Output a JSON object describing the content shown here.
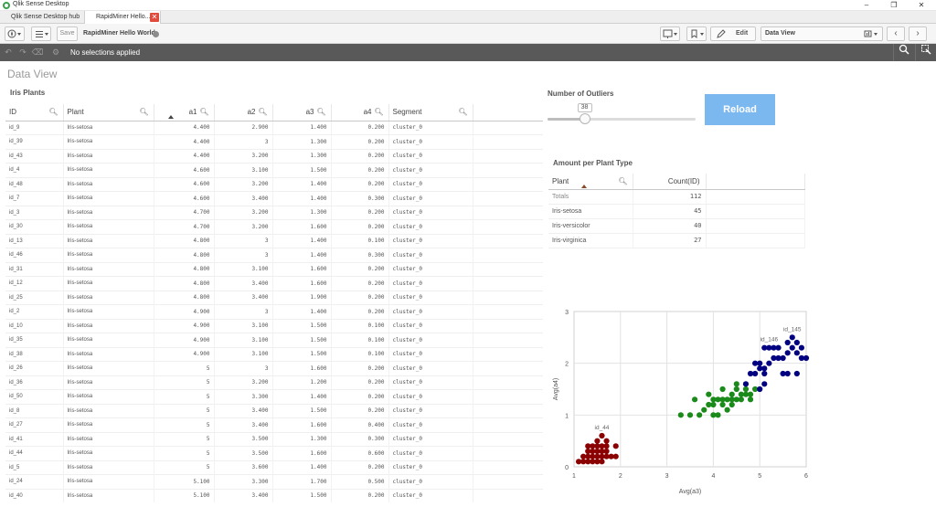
{
  "window": {
    "title": "Qlik Sense Desktop",
    "minimize": "–",
    "maximize": "❐",
    "close": "✕"
  },
  "tabs": [
    {
      "label": "Qlik Sense Desktop hub"
    },
    {
      "label": "RapidMiner Hello..."
    }
  ],
  "tab_close_glyph": "✕",
  "toolbar": {
    "save_label": "Save",
    "app_name": "RapidMiner Hello World",
    "edit_label": "Edit",
    "sheet_name": "Data View",
    "prev": "‹",
    "next": "›"
  },
  "selections": {
    "text": "No selections applied"
  },
  "sheet": {
    "title": "Data View"
  },
  "iris_table": {
    "title": "Iris Plants",
    "columns": [
      "ID",
      "Plant",
      "a1",
      "a2",
      "a3",
      "a4",
      "Segment"
    ],
    "rows": [
      [
        "id_9",
        "Iris-setosa",
        "4.400",
        "2.900",
        "1.400",
        "0.200",
        "cluster_0"
      ],
      [
        "id_39",
        "Iris-setosa",
        "4.400",
        "3",
        "1.300",
        "0.200",
        "cluster_0"
      ],
      [
        "id_43",
        "Iris-setosa",
        "4.400",
        "3.200",
        "1.300",
        "0.200",
        "cluster_0"
      ],
      [
        "id_4",
        "Iris-setosa",
        "4.600",
        "3.100",
        "1.500",
        "0.200",
        "cluster_0"
      ],
      [
        "id_48",
        "Iris-setosa",
        "4.600",
        "3.200",
        "1.400",
        "0.200",
        "cluster_0"
      ],
      [
        "id_7",
        "Iris-setosa",
        "4.600",
        "3.400",
        "1.400",
        "0.300",
        "cluster_0"
      ],
      [
        "id_3",
        "Iris-setosa",
        "4.700",
        "3.200",
        "1.300",
        "0.200",
        "cluster_0"
      ],
      [
        "id_30",
        "Iris-setosa",
        "4.700",
        "3.200",
        "1.600",
        "0.200",
        "cluster_0"
      ],
      [
        "id_13",
        "Iris-setosa",
        "4.800",
        "3",
        "1.400",
        "0.100",
        "cluster_0"
      ],
      [
        "id_46",
        "Iris-setosa",
        "4.800",
        "3",
        "1.400",
        "0.300",
        "cluster_0"
      ],
      [
        "id_31",
        "Iris-setosa",
        "4.800",
        "3.100",
        "1.600",
        "0.200",
        "cluster_0"
      ],
      [
        "id_12",
        "Iris-setosa",
        "4.800",
        "3.400",
        "1.600",
        "0.200",
        "cluster_0"
      ],
      [
        "id_25",
        "Iris-setosa",
        "4.800",
        "3.400",
        "1.900",
        "0.200",
        "cluster_0"
      ],
      [
        "id_2",
        "Iris-setosa",
        "4.900",
        "3",
        "1.400",
        "0.200",
        "cluster_0"
      ],
      [
        "id_10",
        "Iris-setosa",
        "4.900",
        "3.100",
        "1.500",
        "0.100",
        "cluster_0"
      ],
      [
        "id_35",
        "Iris-setosa",
        "4.900",
        "3.100",
        "1.500",
        "0.100",
        "cluster_0"
      ],
      [
        "id_38",
        "Iris-setosa",
        "4.900",
        "3.100",
        "1.500",
        "0.100",
        "cluster_0"
      ],
      [
        "id_26",
        "Iris-setosa",
        "5",
        "3",
        "1.600",
        "0.200",
        "cluster_0"
      ],
      [
        "id_36",
        "Iris-setosa",
        "5",
        "3.200",
        "1.200",
        "0.200",
        "cluster_0"
      ],
      [
        "id_50",
        "Iris-setosa",
        "5",
        "3.300",
        "1.400",
        "0.200",
        "cluster_0"
      ],
      [
        "id_8",
        "Iris-setosa",
        "5",
        "3.400",
        "1.500",
        "0.200",
        "cluster_0"
      ],
      [
        "id_27",
        "Iris-setosa",
        "5",
        "3.400",
        "1.600",
        "0.400",
        "cluster_0"
      ],
      [
        "id_41",
        "Iris-setosa",
        "5",
        "3.500",
        "1.300",
        "0.300",
        "cluster_0"
      ],
      [
        "id_44",
        "Iris-setosa",
        "5",
        "3.500",
        "1.600",
        "0.600",
        "cluster_0"
      ],
      [
        "id_5",
        "Iris-setosa",
        "5",
        "3.600",
        "1.400",
        "0.200",
        "cluster_0"
      ],
      [
        "id_24",
        "Iris-setosa",
        "5.100",
        "3.300",
        "1.700",
        "0.500",
        "cluster_0"
      ],
      [
        "id_40",
        "Iris-setosa",
        "5.100",
        "3.400",
        "1.500",
        "0.200",
        "cluster_0"
      ]
    ]
  },
  "outliers": {
    "title": "Number of Outliers",
    "value": "38",
    "fraction": 0.25
  },
  "reload": {
    "label": "Reload",
    "color": "#7cb8f0"
  },
  "amount_table": {
    "title": "Amount per Plant Type",
    "columns": [
      "Plant",
      "Count(ID)"
    ],
    "totals_label": "Totals",
    "totals_value": "112",
    "rows": [
      [
        "Iris-setosa",
        "45"
      ],
      [
        "Iris-versicolor",
        "40"
      ],
      [
        "Iris-virginica",
        "27"
      ]
    ]
  },
  "chart_data": {
    "type": "scatter",
    "xlabel": "Avg(a3)",
    "ylabel": "Avg(a4)",
    "xlim": [
      1,
      6
    ],
    "ylim": [
      0,
      3
    ],
    "xticks": [
      "1",
      "2",
      "3",
      "4",
      "5",
      "6"
    ],
    "yticks": [
      "0",
      "1",
      "2",
      "3"
    ],
    "grid": true,
    "series": [
      {
        "color": "#8b0000",
        "points": [
          [
            1.4,
            0.2
          ],
          [
            1.5,
            0.2
          ],
          [
            1.3,
            0.2
          ],
          [
            1.6,
            0.2
          ],
          [
            1.4,
            0.3
          ],
          [
            1.5,
            0.3
          ],
          [
            1.7,
            0.3
          ],
          [
            1.2,
            0.2
          ],
          [
            1.6,
            0.4
          ],
          [
            1.5,
            0.4
          ],
          [
            1.3,
            0.3
          ],
          [
            1.9,
            0.2
          ],
          [
            1.4,
            0.1
          ],
          [
            1.5,
            0.1
          ],
          [
            1.1,
            0.1
          ],
          [
            1.7,
            0.5
          ],
          [
            1.6,
            0.6
          ],
          [
            1.3,
            0.4
          ],
          [
            1.9,
            0.4
          ],
          [
            1.7,
            0.2
          ],
          [
            1.4,
            0.4
          ],
          [
            1.8,
            0.2
          ],
          [
            1.6,
            0.3
          ],
          [
            1.2,
            0.1
          ],
          [
            1.5,
            0.5
          ],
          [
            1.7,
            0.4
          ],
          [
            1.3,
            0.1
          ],
          [
            1.6,
            0.1
          ]
        ]
      },
      {
        "color": "#1a8a1a",
        "points": [
          [
            3.6,
            1.3
          ],
          [
            3.5,
            1.0
          ],
          [
            3.9,
            1.4
          ],
          [
            3.7,
            1.0
          ],
          [
            3.8,
            1.1
          ],
          [
            3.9,
            1.2
          ],
          [
            4.0,
            1.3
          ],
          [
            4.1,
            1.3
          ],
          [
            4.0,
            1.0
          ],
          [
            4.2,
            1.2
          ],
          [
            4.3,
            1.3
          ],
          [
            4.4,
            1.4
          ],
          [
            4.5,
            1.5
          ],
          [
            4.6,
            1.4
          ],
          [
            4.4,
            1.2
          ],
          [
            4.0,
            1.2
          ],
          [
            4.2,
            1.3
          ],
          [
            4.1,
            1.0
          ],
          [
            4.5,
            1.3
          ],
          [
            4.7,
            1.4
          ],
          [
            4.4,
            1.3
          ],
          [
            4.8,
            1.4
          ],
          [
            4.7,
            1.5
          ],
          [
            4.9,
            1.5
          ],
          [
            4.6,
            1.3
          ],
          [
            4.5,
            1.6
          ],
          [
            4.3,
            1.1
          ],
          [
            3.3,
            1.0
          ],
          [
            4.2,
            1.5
          ],
          [
            4.8,
            1.3
          ]
        ]
      },
      {
        "color": "#000080",
        "points": [
          [
            4.9,
            1.8
          ],
          [
            5.1,
            1.9
          ],
          [
            5.0,
            2.0
          ],
          [
            5.3,
            2.1
          ],
          [
            5.6,
            2.4
          ],
          [
            5.4,
            2.3
          ],
          [
            5.1,
            2.3
          ],
          [
            5.7,
            2.5
          ],
          [
            5.8,
            2.2
          ],
          [
            5.6,
            1.8
          ],
          [
            6.0,
            2.1
          ],
          [
            5.9,
            2.3
          ],
          [
            5.5,
            2.1
          ],
          [
            5.2,
            2.0
          ],
          [
            5.0,
            1.5
          ],
          [
            5.8,
            1.8
          ],
          [
            5.7,
            2.3
          ],
          [
            4.8,
            1.8
          ],
          [
            4.9,
            2.0
          ],
          [
            5.1,
            1.6
          ],
          [
            5.3,
            2.3
          ],
          [
            5.6,
            2.2
          ],
          [
            5.9,
            2.1
          ],
          [
            5.4,
            2.1
          ],
          [
            5.2,
            2.3
          ],
          [
            5.1,
            1.8
          ],
          [
            5.0,
            1.9
          ],
          [
            5.5,
            1.8
          ],
          [
            4.7,
            1.6
          ],
          [
            5.8,
            2.4
          ]
        ]
      }
    ],
    "annotations": [
      {
        "text": "id_44",
        "x": 1.6,
        "y": 0.6
      },
      {
        "text": "id_146",
        "x": 5.2,
        "y": 2.3
      },
      {
        "text": "id_145",
        "x": 5.7,
        "y": 2.5
      }
    ]
  }
}
